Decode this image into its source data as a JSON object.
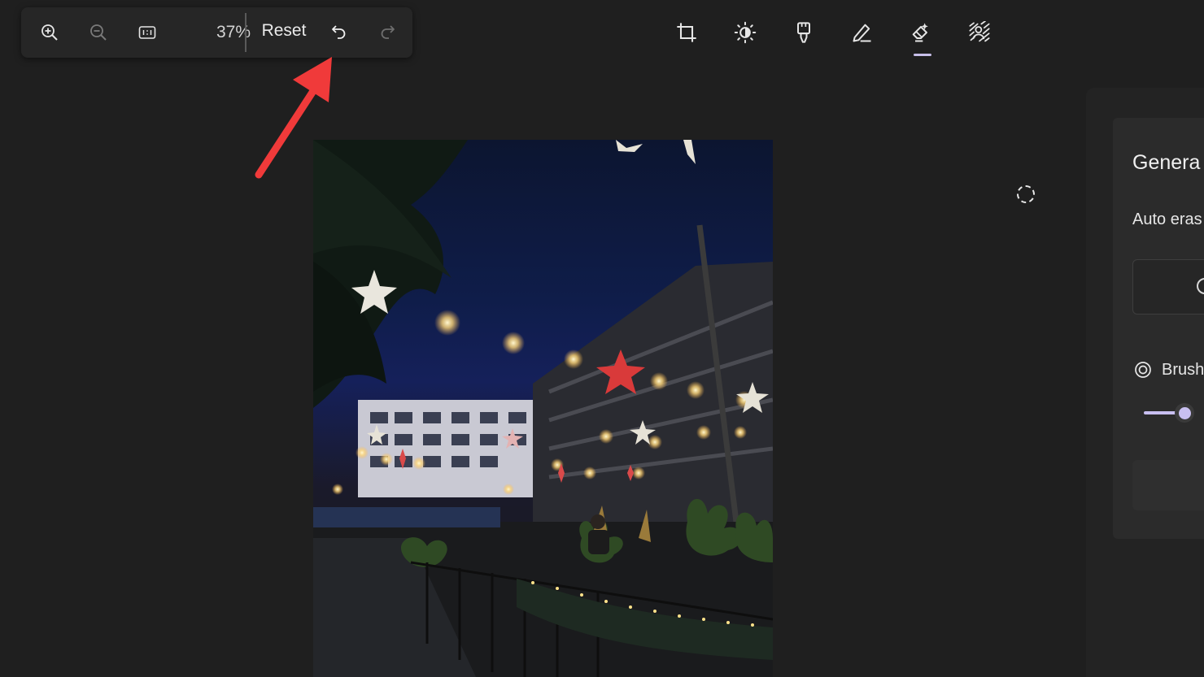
{
  "toolbar": {
    "zoom_level": "37%",
    "reset_label": "Reset",
    "icons": [
      "zoom-in-icon",
      "zoom-out-icon",
      "actual-size-icon",
      "undo-icon",
      "redo-icon"
    ]
  },
  "tools": {
    "items": [
      "crop-icon",
      "adjust-brightness-icon",
      "filter-icon",
      "markup-icon",
      "erase-icon",
      "background-blur-icon"
    ],
    "active": "erase-icon"
  },
  "side_panel": {
    "title": "Genera",
    "auto_erase_label": "Auto eras",
    "brush_label": "Brush",
    "brush_size_fraction": 0.25
  },
  "colors": {
    "accent": "#c7bfe9",
    "annotation_arrow": "#f03a3a"
  }
}
